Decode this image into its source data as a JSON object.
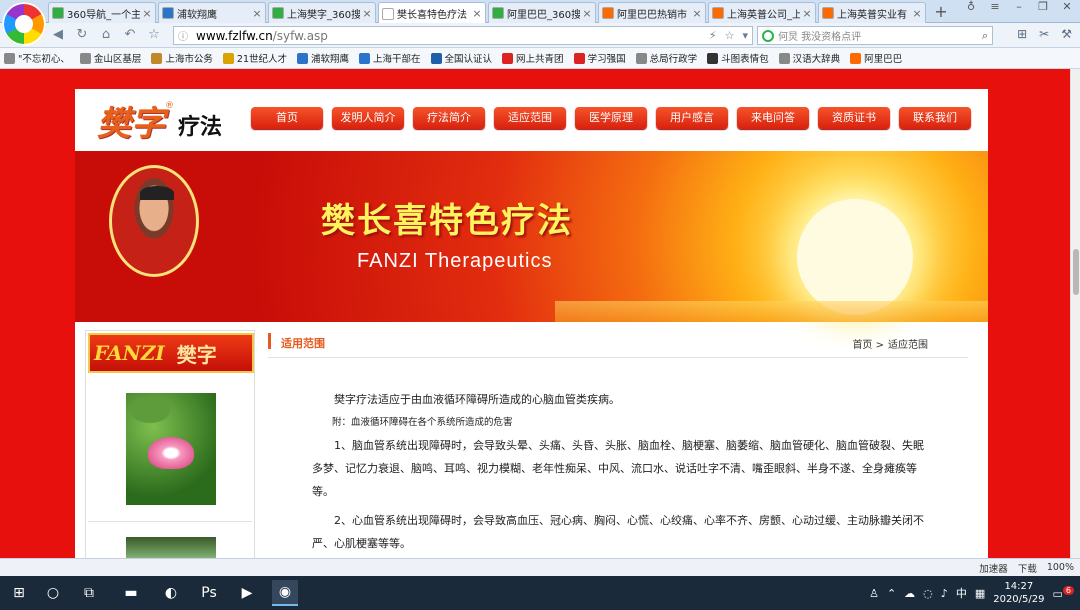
{
  "browser": {
    "tabs": [
      {
        "label": "360导航_一个主",
        "icon_color": "#2fae42",
        "active": false
      },
      {
        "label": "浦软翔鹰",
        "icon_color": "#2a74c9",
        "active": false
      },
      {
        "label": "上海樊字_360搜",
        "icon_color": "#2fae42",
        "active": false
      },
      {
        "label": "樊长喜特色疗法",
        "icon_color": "#ffffff",
        "active": true
      },
      {
        "label": "阿里巴巴_360搜",
        "icon_color": "#2fae42",
        "active": false
      },
      {
        "label": "阿里巴巴热销市",
        "icon_color": "#ff6a00",
        "active": false
      },
      {
        "label": "上海英普公司_上",
        "icon_color": "#ff6a00",
        "active": false
      },
      {
        "label": "上海英普实业有",
        "icon_color": "#ff6a00",
        "active": false
      }
    ],
    "new_tab": "+",
    "url_host": "www.fzlfw.cn",
    "url_path": "/syfw.asp",
    "search_value": "何炅 我没资格点评",
    "bookmarks": [
      {
        "label": "\"不忘初心、",
        "color": "#888888"
      },
      {
        "label": "金山区基层",
        "color": "#888888"
      },
      {
        "label": "上海市公务",
        "color": "#c08a2a"
      },
      {
        "label": "21世纪人才",
        "color": "#d9a400"
      },
      {
        "label": "浦软翔鹰",
        "color": "#2a74c9"
      },
      {
        "label": "上海干部在",
        "color": "#2a74c9"
      },
      {
        "label": "全国认证认",
        "color": "#1f5fa8"
      },
      {
        "label": "网上共青团",
        "color": "#d22"
      },
      {
        "label": "学习强国",
        "color": "#d22"
      },
      {
        "label": "总局行政学",
        "color": "#888888"
      },
      {
        "label": "斗图表情包",
        "color": "#333333"
      },
      {
        "label": "汉语大辞典",
        "color": "#888888"
      },
      {
        "label": "阿里巴巴",
        "color": "#ff6a00"
      }
    ],
    "status": {
      "accelerate": "加速器",
      "download": "下载",
      "zoom": "100%"
    }
  },
  "site": {
    "brand_main": "樊字",
    "brand_reg": "®",
    "brand_sub": "疗法",
    "nav": [
      "首页",
      "发明人简介",
      "疗法简介",
      "适应范围",
      "医学原理",
      "用户感言",
      "来电问答",
      "资质证书",
      "联系我们"
    ],
    "banner_title": "樊长喜特色疗法",
    "banner_sub": "FANZI Therapeutics",
    "sidebar_logo_en": "FANZI",
    "sidebar_logo_cn": "樊字",
    "section_title": "适用范围",
    "breadcrumb_home": "首页 >",
    "breadcrumb_current": "适应范围",
    "intro": "樊字疗法适应于由血液循环障碍所造成的心脑血管类疾病。",
    "note": "附：血液循环障碍在各个系统所造成的危害",
    "paragraphs": [
      "1、脑血管系统出现障碍时，会导致头晕、头痛、头昏、头胀、脑血栓、脑梗塞、脑萎缩、脑血管硬化、脑血管破裂、失眠多梦、记忆力衰退、脑鸣、耳鸣、视力模糊、老年性痴呆、中风、流口水、说话吐字不清、嘴歪眼斜、半身不遂、全身瘫痪等等。",
      "2、心血管系统出现障碍时，会导致高血压、冠心病、胸闷、心慌、心绞痛、心率不齐、房颤、心动过缓、主动脉瓣关闭不严、心肌梗塞等等。"
    ]
  },
  "taskbar": {
    "time": "14:27",
    "date": "2020/5/29",
    "ime": "中",
    "notify_count": "6"
  }
}
